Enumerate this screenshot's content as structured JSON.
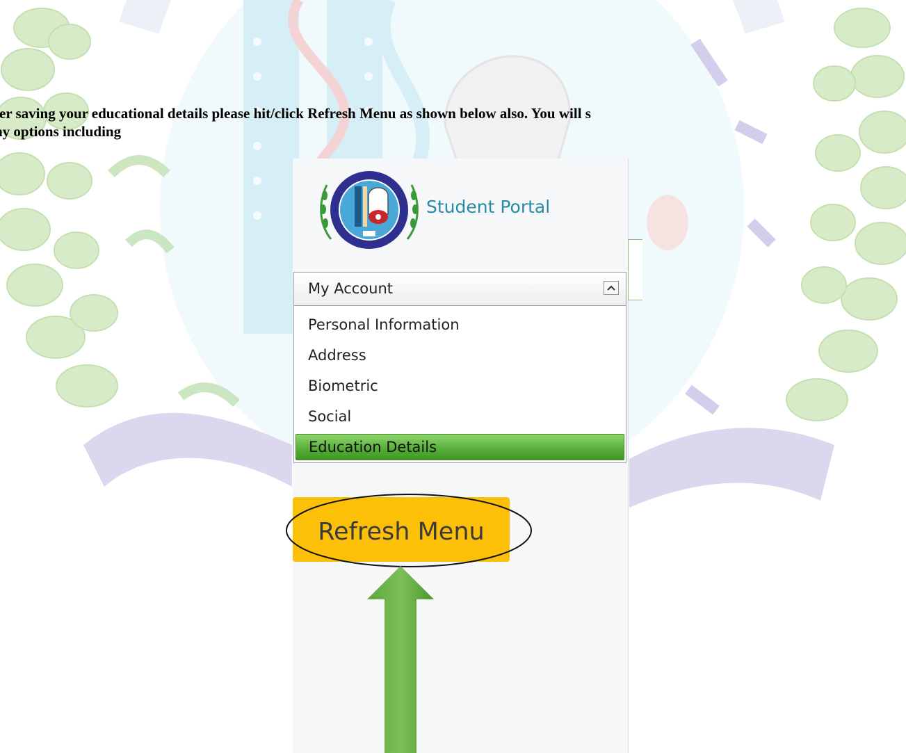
{
  "instruction": {
    "line1": "ter saving your educational details please hit/click Refresh Menu as shown below also. You will s",
    "line2": "ny options including"
  },
  "portal": {
    "brand_name": "Student Portal",
    "logo_icon": "university-seal-icon",
    "account_section": {
      "title": "My Account",
      "collapse_icon": "chevron-up-icon",
      "items": [
        {
          "label": "Personal Information",
          "active": false
        },
        {
          "label": "Address",
          "active": false
        },
        {
          "label": "Biometric",
          "active": false
        },
        {
          "label": "Social",
          "active": false
        },
        {
          "label": "Education Details",
          "active": true
        }
      ]
    },
    "refresh_button": {
      "label": "Refresh Menu"
    },
    "annotation": {
      "arrow_icon": "arrow-up-icon",
      "highlight_icon": "ellipse-highlight-icon"
    }
  },
  "colors": {
    "brand_text": "#2a8aa5",
    "active_item": "#55ad37",
    "refresh_button": "#fdc009",
    "arrow": "#6ab04c",
    "watermark_green": "#d7ebc8",
    "watermark_blue": "#d6eef6",
    "watermark_purple": "#dcd6ef"
  }
}
